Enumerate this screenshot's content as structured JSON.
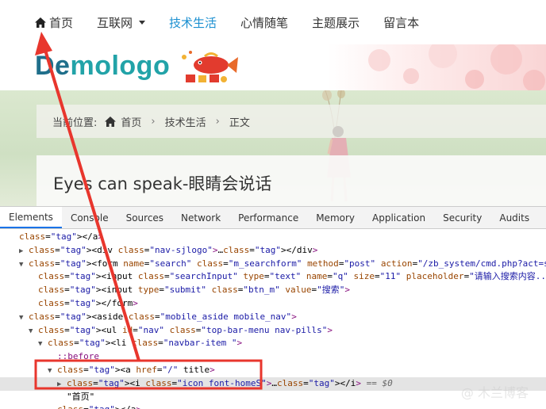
{
  "nav": {
    "items": [
      {
        "label": "首页",
        "active": false,
        "dropdown": false,
        "icon": "home-icon"
      },
      {
        "label": "互联网",
        "active": false,
        "dropdown": true
      },
      {
        "label": "技术生活",
        "active": true,
        "dropdown": false
      },
      {
        "label": "心情随笔",
        "active": false,
        "dropdown": false
      },
      {
        "label": "主题展示",
        "active": false,
        "dropdown": false
      },
      {
        "label": "留言本",
        "active": false,
        "dropdown": false
      }
    ],
    "accent_color": "#1a8fd0"
  },
  "logo": {
    "part1": "De",
    "part2": "mologo"
  },
  "breadcrumb": {
    "prefix": "当前位置:",
    "home": "首页",
    "category": "技术生活",
    "current": "正文"
  },
  "article": {
    "title": "Eyes can speak-眼睛会说话"
  },
  "devtools": {
    "tabs": [
      "Elements",
      "Console",
      "Sources",
      "Network",
      "Performance",
      "Memory",
      "Application",
      "Security",
      "Audits"
    ],
    "active_tab": "Elements",
    "dom_lines": [
      {
        "indent": 0,
        "tri": "",
        "html": "</a>"
      },
      {
        "indent": 1,
        "tri": "▶",
        "html": "<div class=\"nav-sjlogo\">…</div>"
      },
      {
        "indent": 1,
        "tri": "▼",
        "html": "<form name=\"search\" class=\"m_searchform\" method=\"post\" action=\"/zb_system/cmd.php?act=search\">"
      },
      {
        "indent": 2,
        "tri": "",
        "html": "<input class=\"searchInput\" type=\"text\" name=\"q\" size=\"11\" placeholder=\"请输入搜索内容...\" value"
      },
      {
        "indent": 2,
        "tri": "",
        "html": "<input type=\"submit\" class=\"btn_m\" value=\"搜索\">"
      },
      {
        "indent": 2,
        "tri": "",
        "html": "</form>"
      },
      {
        "indent": 1,
        "tri": "▼",
        "html": "<aside class=\"mobile_aside mobile_nav\">"
      },
      {
        "indent": 2,
        "tri": "▼",
        "html": "<ul id=\"nav\" class=\"top-bar-menu nav-pills\">"
      },
      {
        "indent": 3,
        "tri": "▼",
        "html": "<li class=\"navbar-item \">"
      },
      {
        "indent": 4,
        "tri": "",
        "html": "::before"
      },
      {
        "indent": 4,
        "tri": "▼",
        "html": "<a href=\"/\" title>"
      },
      {
        "indent": 5,
        "tri": "▶",
        "html": "<i class=\"icon font-homeS\">…</i> == $0",
        "selected": true
      },
      {
        "indent": 5,
        "tri": "",
        "html": "\"首页\""
      },
      {
        "indent": 4,
        "tri": "",
        "html": "</a>"
      }
    ]
  },
  "watermark": "@ 木兰博客"
}
